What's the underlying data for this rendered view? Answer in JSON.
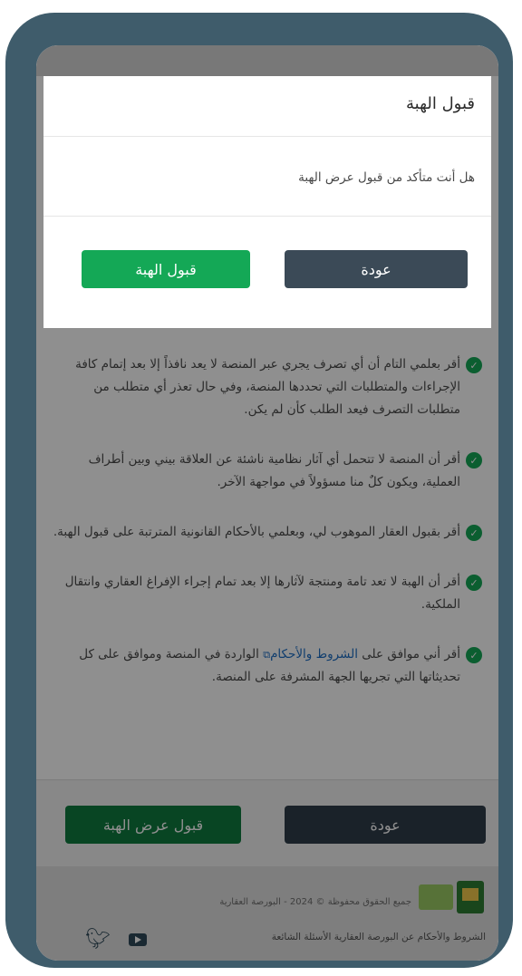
{
  "modal": {
    "title": "قبول الهبة",
    "message": "هل أنت متأكد من قبول عرض الهبة",
    "back_label": "عودة",
    "accept_label": "قبول الهبة"
  },
  "terms": [
    "أقر بعلمي التام أن أي تصرف يجري عبر المنصة لا يعد نافذاً إلا بعد إتمام كافة الإجراءات والمتطلبات التي تحددها المنصة، وفي حال تعذر أي متطلب من متطلبات التصرف فيعد الطلب كأن لم يكن.",
    "أقر أن المنصة لا تتحمل أي آثار نظامية ناشئة عن العلاقة بيني وبين أطراف العملية، ويكون كلٌ منا مسؤولاً في مواجهة الآخر.",
    "أقر بقبول العقار الموهوب لي، وبعلمي بالأحكام القانونية المترتبة على قبول الهبة.",
    "أقر أن الهبة لا تعد تامة ومنتجة لآثارها إلا بعد تمام إجراء الإفراغ العقاري وانتقال الملكية."
  ],
  "last_term": {
    "prefix": "أقر أني موافق على",
    "link": "الشروط والأحكام",
    "suffix": "الواردة في المنصة وموافق على كل تحديثاتها التي تجريها الجهة المشرفة على المنصة."
  },
  "page_actions": {
    "back_label": "عودة",
    "accept_offer_label": "قبول عرض الهبة"
  },
  "footer": {
    "copyright": "جميع الحقوق محفوظة © 2024 - البورصة العقارية",
    "links": "الشروط والأحكام   عن البورصة العقارية   الأسئلة الشائعة"
  },
  "colors": {
    "frame": "#3f5c6b",
    "accent_green": "#14a856",
    "dark_button": "#2f3d4a",
    "link_blue": "#1f6fc5"
  },
  "icons": [
    "check-circle-icon",
    "external-link-icon",
    "twitter-icon",
    "youtube-icon"
  ]
}
